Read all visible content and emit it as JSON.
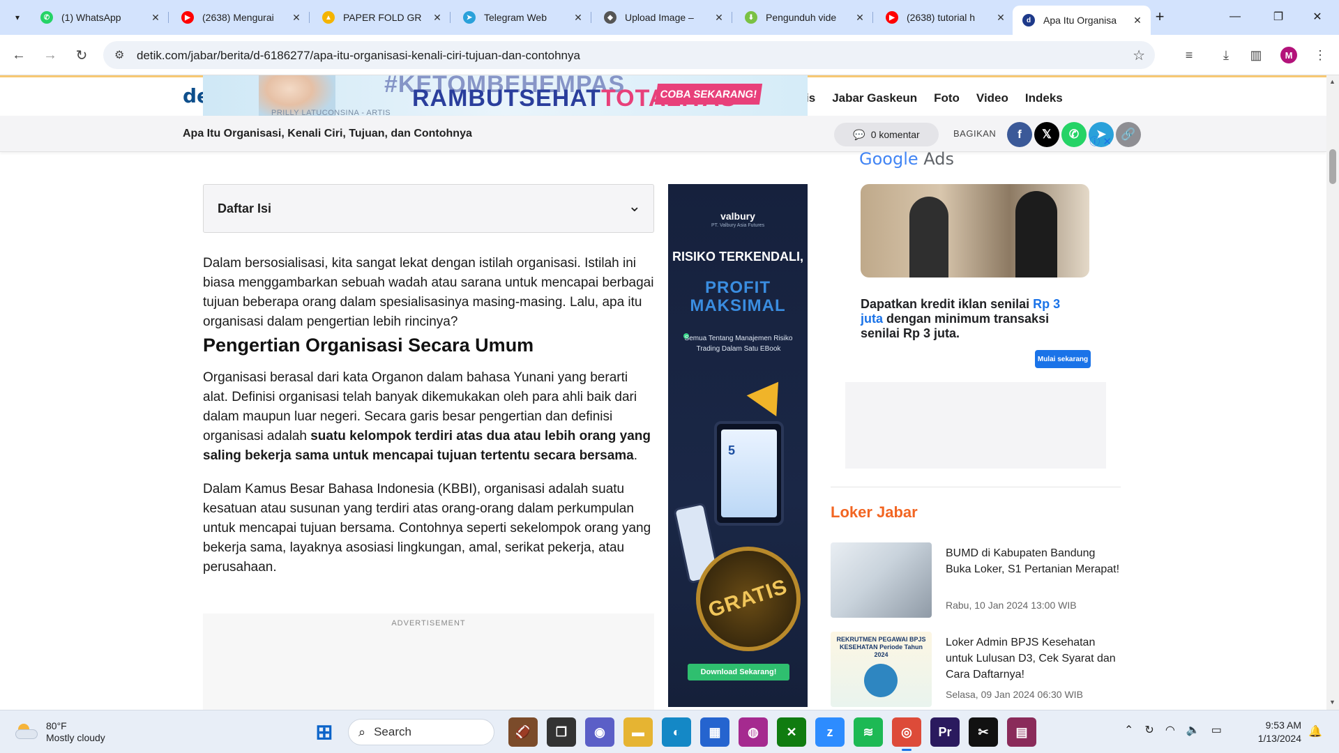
{
  "browser": {
    "tabs": [
      {
        "title": "(1) WhatsApp",
        "icon": "whatsapp-icon",
        "color": "#25d366",
        "glyph": "✆"
      },
      {
        "title": "(2638) Mengurai",
        "icon": "youtube-icon",
        "color": "#ff0000",
        "glyph": "▶"
      },
      {
        "title": "PAPER FOLD GR",
        "icon": "google-drive-icon",
        "color": "#f4b400",
        "glyph": "▲"
      },
      {
        "title": "Telegram Web",
        "icon": "telegram-icon",
        "color": "#2aa1da",
        "glyph": "➤"
      },
      {
        "title": "Upload Image –",
        "icon": "upload-icon",
        "color": "#555555",
        "glyph": "◆"
      },
      {
        "title": "Pengunduh vide",
        "icon": "download-icon",
        "color": "#7ac143",
        "glyph": "⬇"
      },
      {
        "title": "(2638) tutorial h",
        "icon": "youtube-icon",
        "color": "#ff0000",
        "glyph": "▶"
      },
      {
        "title": "Apa Itu Organisa",
        "icon": "detik-icon",
        "color": "#1e3a8a",
        "glyph": "d"
      }
    ],
    "url": "detik.com/jabar/berita/d-6186277/apa-itu-organisasi-kenali-ciri-tujuan-dan-contohnya",
    "profile_initial": "M"
  },
  "site": {
    "logo": "de",
    "nav": [
      "is",
      "Jabar Gaskeun",
      "Foto",
      "Video",
      "Indeks"
    ]
  },
  "banner": {
    "tagline_a": "RAMBUTSEHAT",
    "tagline_b": "TOTALITAS",
    "tag_top": "#KETOMBEHEMPAS",
    "cta": "COBA SEKARANG!",
    "caption": "PRILLY LATUCONSINA - ARTIS"
  },
  "sticky": {
    "title": "Apa Itu Organisasi, Kenali Ciri, Tujuan, dan Contohnya",
    "comments": "0 komentar",
    "share_label": "BAGIKAN",
    "share": [
      {
        "name": "facebook",
        "color": "#3b5998",
        "glyph": "f"
      },
      {
        "name": "x",
        "color": "#000000",
        "glyph": "𝕏"
      },
      {
        "name": "whatsapp",
        "color": "#25d366",
        "glyph": "✆"
      },
      {
        "name": "telegram",
        "color": "#2aa1da",
        "glyph": "➤"
      },
      {
        "name": "copy-link",
        "color": "#8e8e93",
        "glyph": "🔗"
      }
    ]
  },
  "article": {
    "toc_label": "Daftar Isi",
    "p1": "Dalam bersosialisasi, kita sangat lekat dengan istilah organisasi. Istilah ini biasa menggambarkan sebuah wadah atau sarana untuk mencapai berbagai tujuan beberapa orang dalam spesialisasinya masing-masing. Lalu, apa itu organisasi dalam pengertian lebih rincinya?",
    "h2": "Pengertian Organisasi Secara Umum",
    "p2_start": "Organisasi berasal dari kata Organon dalam bahasa Yunani yang berarti alat. Definisi organisasi telah banyak dikemukakan oleh para ahli baik dari dalam maupun luar negeri. Secara garis besar pengertian dan definisi organisasi adalah ",
    "p2_bold": "suatu kelompok terdiri atas dua atau lebih orang yang saling bekerja sama untuk mencapai tujuan tertentu secara bersama",
    "p2_end": ".",
    "p3": "Dalam Kamus Besar Bahasa Indonesia (KBBI), organisasi adalah suatu kesatuan atau susunan yang terdiri atas orang-orang dalam perkumpulan untuk mencapai tujuan bersama. Contohnya seperti sekelompok orang yang bekerja sama, layaknya asosiasi lingkungan, amal, serikat pekerja, atau perusahaan.",
    "ad_label": "ADVERTISEMENT"
  },
  "vertical_ad": {
    "brand": "valbury",
    "brand_sub": "PT. Valbury Asia Futures",
    "headline_1": "RISIKO TERKENDALI,",
    "headline_2": "PROFIT MAKSIMAL",
    "desc": "Semua Tentang Manajemen Risiko Trading Dalam Satu EBook",
    "ebook_num": "5",
    "badge": "GRATIS",
    "download": "Download Sekarang!"
  },
  "google_ad": {
    "logo_google": "Google",
    "logo_ads": "Ads",
    "text_a": "Dapatkan kredit iklan senilai ",
    "text_blue": "Rp 3 juta",
    "text_b": " dengan minimum transaksi senilai Rp 3 juta.",
    "button": "Mulai sekarang"
  },
  "loker": {
    "title": "Loker Jabar",
    "items": [
      {
        "title": "BUMD di Kabupaten Bandung Buka Loker, S1 Pertanian Merapat!",
        "date": "Rabu, 10 Jan 2024 13:00 WIB"
      },
      {
        "title": "Loker Admin BPJS Kesehatan untuk Lulusan D3, Cek Syarat dan Cara Daftarnya!",
        "date": "Selasa, 09 Jan 2024 06:30 WIB",
        "thumb_caption": "REKRUTMEN PEGAWAI BPJS KESEHATAN Periode Tahun 2024"
      }
    ]
  },
  "taskbar": {
    "temp": "80°F",
    "weather": "Mostly cloudy",
    "search": "Search",
    "time": "9:53 AM",
    "date": "1/13/2024",
    "apps": [
      {
        "name": "start-icon",
        "color": "#0a63c9",
        "glyph": "⊞"
      },
      {
        "name": "widgets-icon",
        "color": "#7b4b2a",
        "glyph": "🏈"
      },
      {
        "name": "task-view-icon",
        "color": "#333333",
        "glyph": "❐"
      },
      {
        "name": "teams-icon",
        "color": "#5b5fc7",
        "glyph": "◉"
      },
      {
        "name": "file-explorer-icon",
        "color": "#e6b432",
        "glyph": "▬"
      },
      {
        "name": "edge-icon",
        "color": "#1488c6",
        "glyph": "◐"
      },
      {
        "name": "store-icon",
        "color": "#2564cf",
        "glyph": "▦"
      },
      {
        "name": "photos-icon",
        "color": "#a52a8f",
        "glyph": "◍"
      },
      {
        "name": "xbox-icon",
        "color": "#107c10",
        "glyph": "✕"
      },
      {
        "name": "zoom-icon",
        "color": "#2d8cff",
        "glyph": "z"
      },
      {
        "name": "spotify-icon",
        "color": "#1db954",
        "glyph": "≋"
      },
      {
        "name": "chrome-icon",
        "color": "#dd4b39",
        "glyph": "◎"
      },
      {
        "name": "premiere-icon",
        "color": "#2a1a5e",
        "glyph": "Pr"
      },
      {
        "name": "capcut-icon",
        "color": "#111111",
        "glyph": "✂"
      },
      {
        "name": "winrar-icon",
        "color": "#8a2b5a",
        "glyph": "▤"
      }
    ]
  }
}
